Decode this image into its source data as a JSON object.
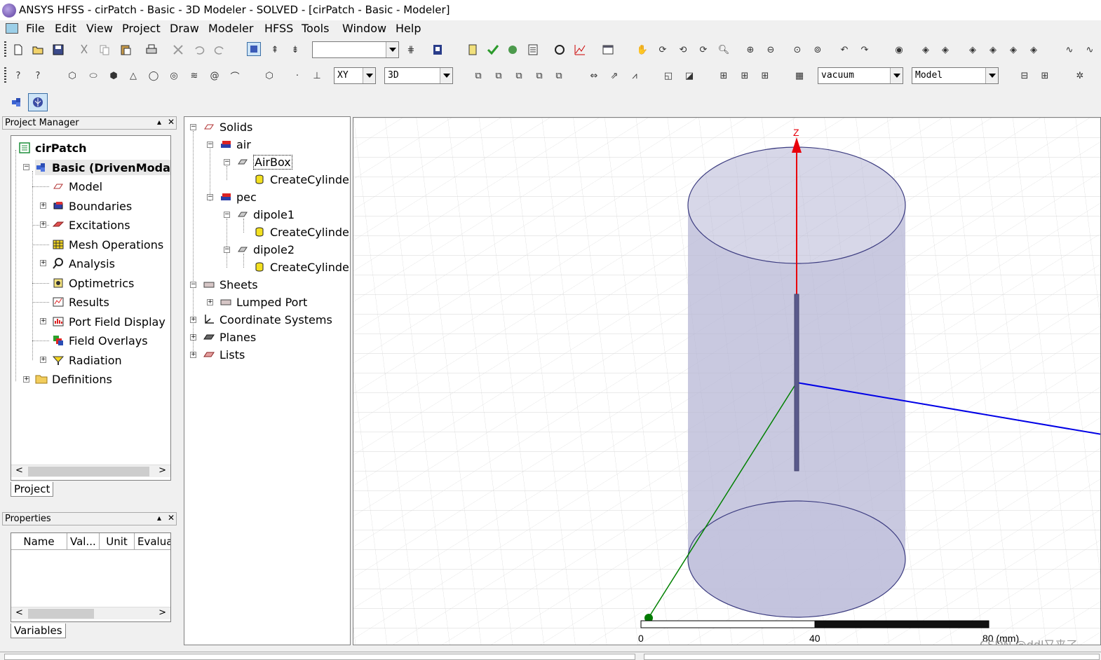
{
  "window": {
    "title": "ANSYS HFSS - cirPatch - Basic - 3D Modeler - SOLVED - [cirPatch - Basic - Modeler]"
  },
  "menu": [
    "File",
    "Edit",
    "View",
    "Project",
    "Draw",
    "Modeler",
    "HFSS",
    "Tools",
    "Window",
    "Help"
  ],
  "toolbar": {
    "plane_select": "XY",
    "dim_select": "3D",
    "material_select": "vacuum",
    "mode_select": "Model",
    "empty_select": ""
  },
  "project_manager": {
    "header": "Project Manager",
    "project": "cirPatch",
    "design": "Basic (DrivenModal)",
    "items": [
      "Model",
      "Boundaries",
      "Excitations",
      "Mesh Operations",
      "Analysis",
      "Optimetrics",
      "Results",
      "Port Field Display",
      "Field Overlays",
      "Radiation"
    ],
    "definitions": "Definitions",
    "tab": "Project"
  },
  "properties": {
    "header": "Properties",
    "columns": [
      "Name",
      "Val...",
      "Unit",
      "Evalua"
    ],
    "tab": "Variables"
  },
  "model_tree": {
    "solids": "Solids",
    "air": "air",
    "airbox": "AirBox",
    "create_cylinder": "CreateCylinder",
    "pec": "pec",
    "dipole1": "dipole1",
    "dipole2": "dipole2",
    "sheets": "Sheets",
    "lumped_port": "Lumped Port",
    "coordinate_systems": "Coordinate Systems",
    "planes": "Planes",
    "lists": "Lists"
  },
  "viewport": {
    "axis_label": "Z",
    "scale_labels": [
      "0",
      "40",
      "80 (mm)"
    ],
    "watermark": "CSDN @ddl又来了"
  },
  "colors": {
    "z_axis": "#e8000b",
    "x_axis": "#0000e6",
    "y_axis": "#008000",
    "cylinder": "#b7b7d6",
    "dipole": "#5a5a8c"
  }
}
